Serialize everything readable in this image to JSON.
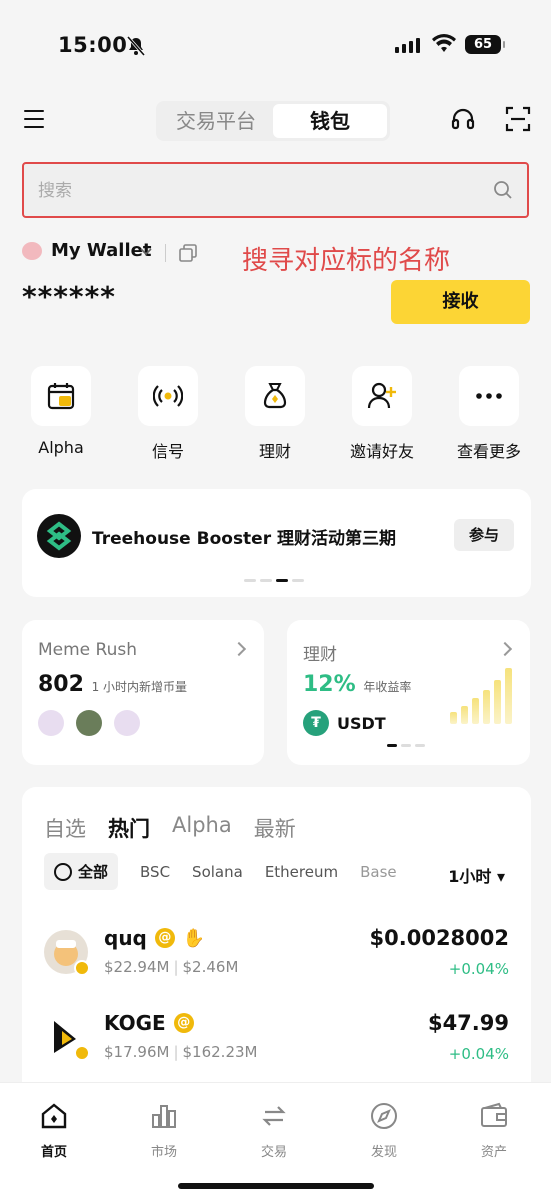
{
  "status_bar": {
    "time": "15:00",
    "battery": "65"
  },
  "header": {
    "tabs": [
      "交易平台",
      "钱包"
    ],
    "active_tab": "钱包"
  },
  "search": {
    "placeholder": "搜索"
  },
  "wallet": {
    "name": "My Wallet",
    "annotation": "搜寻对应标的名称",
    "balance": "******",
    "receive_label": "接收"
  },
  "quick_actions": [
    {
      "label": "Alpha",
      "icon": "calendar-alpha-icon"
    },
    {
      "label": "信号",
      "icon": "broadcast-icon"
    },
    {
      "label": "理财",
      "icon": "money-bag-icon"
    },
    {
      "label": "邀请好友",
      "icon": "add-user-icon"
    },
    {
      "label": "查看更多",
      "icon": "more-icon"
    }
  ],
  "banner": {
    "title": "Treehouse Booster 理财活动第三期",
    "button": "参与"
  },
  "cards": {
    "meme": {
      "title": "Meme Rush",
      "count": "802",
      "desc": "1 小时内新增币量"
    },
    "earn": {
      "title": "理财",
      "apr": "12%",
      "apr_label": "年收益率",
      "asset": "USDT"
    }
  },
  "market": {
    "tabs": [
      "自选",
      "热门",
      "Alpha",
      "最新"
    ],
    "active_tab": "热门",
    "chains": [
      "全部",
      "BSC",
      "Solana",
      "Ethereum",
      "Base"
    ],
    "period": "1小时",
    "rows": [
      {
        "symbol": "quq",
        "mcap": "$22.94M",
        "vol": "$2.46M",
        "price": "$0.0028002",
        "change": "+0.04%"
      },
      {
        "symbol": "KOGE",
        "mcap": "$17.96M",
        "vol": "$162.23M",
        "price": "$47.99",
        "change": "+0.04%"
      }
    ]
  },
  "nav": [
    "首页",
    "市场",
    "交易",
    "发现",
    "资产"
  ]
}
